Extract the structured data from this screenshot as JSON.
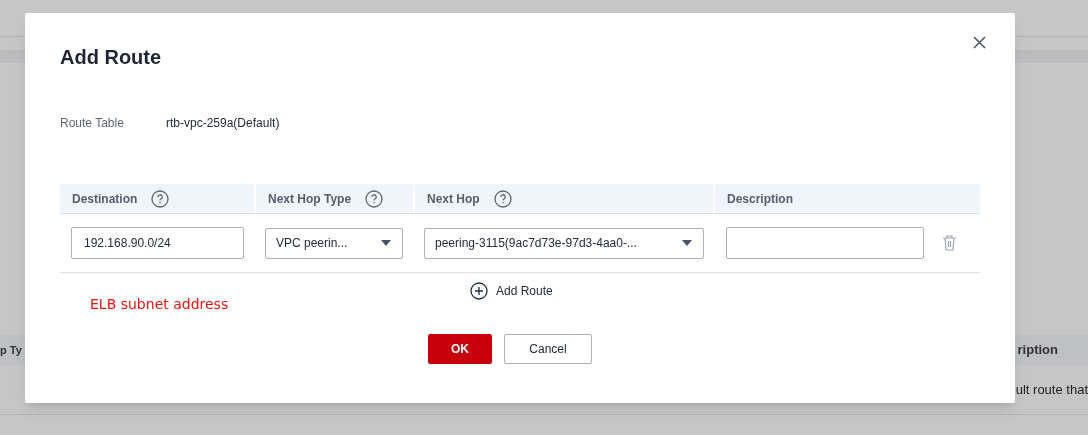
{
  "background": {
    "texts": [
      "p Ty",
      "ription",
      "ult route that"
    ]
  },
  "dialog": {
    "title": "Add Route",
    "route_table": {
      "label": "Route Table",
      "value": "rtb-vpc-259a(Default)"
    },
    "table": {
      "columns": [
        {
          "label": "Destination",
          "help": true
        },
        {
          "label": "Next Hop Type",
          "help": true
        },
        {
          "label": "Next Hop",
          "help": true
        },
        {
          "label": "Description",
          "help": false
        }
      ],
      "rows": [
        {
          "destination": "192.168.90.0/24",
          "next_hop_type": "VPC peerin...",
          "next_hop": "peering-3115(9ac7d73e-97d3-4aa0-..."
        }
      ]
    },
    "add_route": "Add Route",
    "annotation": "ELB subnet address",
    "buttons": [
      {
        "label": "OK",
        "kind": "primary"
      },
      {
        "label": "Cancel",
        "kind": "secondary"
      }
    ]
  }
}
